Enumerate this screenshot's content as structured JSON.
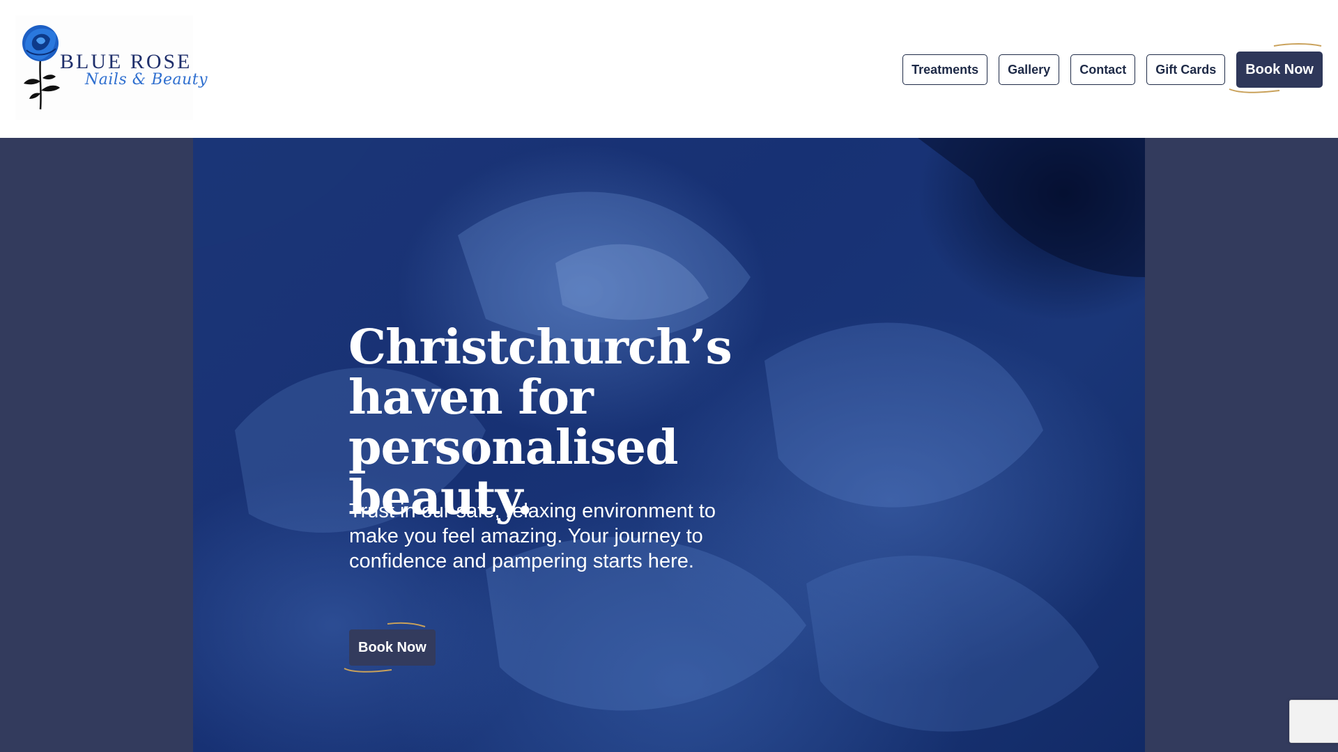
{
  "brand": {
    "name": "BLUE ROSE",
    "tagline": "Nails & Beauty",
    "logo_icon": "blue-rose-icon",
    "colors": {
      "navy": "#1e2a47",
      "button": "#2e3759",
      "rose_blue": "#2f6fcf",
      "gold": "#c9a15a"
    }
  },
  "nav": {
    "items": [
      {
        "label": "Treatments"
      },
      {
        "label": "Gallery"
      },
      {
        "label": "Contact"
      },
      {
        "label": "Gift Cards"
      }
    ],
    "cta_label": "Book Now"
  },
  "hero": {
    "title": "Christchurch’s haven for personalised beauty.",
    "text": "Trust in our safe, relaxing environment to make you feel amazing. Your journey to confidence and pampering starts here.",
    "cta_label": "Book Now",
    "background": "blue-rose-photo"
  }
}
